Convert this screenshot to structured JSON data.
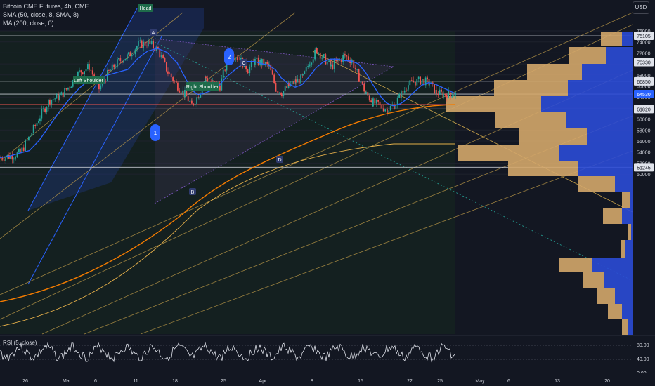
{
  "header": {
    "title": "Bitcoin CME Futures, 4h, CME",
    "sma_label": "SMA (50, close, 8, SMA, 8)",
    "ma_label": "MA (200, close, 0)",
    "currency_button": "USD"
  },
  "colors": {
    "background": "#131722",
    "up": "#26a69a",
    "down": "#ef5350",
    "sma": "#2962ff",
    "ma200": "#f57c00",
    "fib": "#c8a24a",
    "pattern_blue": "#2962ff",
    "pattern_purple": "#9c27b0",
    "volume_sell": "#d4a76a",
    "volume_buy": "#2b4bd6",
    "level_line": "#e0e3eb"
  },
  "rsi": {
    "label": "RSI (5, close)",
    "axis": [
      "80.00",
      "40.00",
      "0.00"
    ]
  },
  "annotations": {
    "head": "Head",
    "left_shoulder": "Left Shoulder",
    "right_shoulder": "Right Shoulder",
    "wave_1": "1",
    "wave_2": "2",
    "point_a": "A",
    "point_b": "B",
    "point_c": "C",
    "point_d": "D"
  },
  "chart_data": {
    "type": "candlestick",
    "title": "Bitcoin CME Futures, 4h, CME",
    "y_axis_ticks": [
      "76000",
      "74000",
      "72000",
      "70000",
      "68000",
      "66000",
      "64000",
      "62000",
      "60000",
      "58000",
      "56000",
      "54000",
      "52000",
      "50000"
    ],
    "ylim": [
      48000,
      76500
    ],
    "x_axis_ticks": [
      "26",
      "Mar",
      "6",
      "11",
      "18",
      "25",
      "Apr",
      "8",
      "15",
      "22",
      "25",
      "May",
      "6",
      "13",
      "20"
    ],
    "price_levels": [
      {
        "label": "75105",
        "value": 75105
      },
      {
        "label": "70330",
        "value": 70330
      },
      {
        "label": "66850",
        "value": 66850
      },
      {
        "label": "64530",
        "value": 64530,
        "current": true
      },
      {
        "label": "61820",
        "value": 61820
      },
      {
        "label": "51245",
        "value": 51245
      }
    ],
    "series": [
      {
        "name": "SMA (50, close, 8, SMA, 8)"
      },
      {
        "name": "MA (200, close, 0)"
      }
    ],
    "close_path": [
      [
        0,
        53000
      ],
      [
        14,
        53300
      ],
      [
        28,
        53800
      ],
      [
        42,
        57000
      ],
      [
        56,
        60500
      ],
      [
        70,
        63500
      ],
      [
        84,
        64000
      ],
      [
        98,
        66000
      ],
      [
        112,
        68500
      ],
      [
        126,
        69500
      ],
      [
        140,
        65500
      ],
      [
        154,
        68500
      ],
      [
        168,
        70500
      ],
      [
        182,
        71500
      ],
      [
        196,
        73500
      ],
      [
        210,
        73800
      ],
      [
        224,
        72500
      ],
      [
        238,
        68500
      ],
      [
        252,
        66000
      ],
      [
        262,
        64500
      ],
      [
        272,
        62500
      ],
      [
        282,
        64500
      ],
      [
        292,
        67500
      ],
      [
        302,
        66500
      ],
      [
        312,
        66000
      ],
      [
        322,
        70500
      ],
      [
        332,
        71800
      ],
      [
        342,
        70500
      ],
      [
        352,
        69000
      ],
      [
        362,
        70500
      ],
      [
        372,
        70200
      ],
      [
        382,
        69500
      ],
      [
        392,
        65500
      ],
      [
        400,
        64800
      ],
      [
        410,
        66000
      ],
      [
        420,
        66800
      ],
      [
        430,
        67500
      ],
      [
        440,
        70500
      ],
      [
        450,
        72500
      ],
      [
        460,
        71000
      ],
      [
        470,
        69500
      ],
      [
        480,
        70500
      ],
      [
        490,
        71500
      ],
      [
        500,
        70500
      ],
      [
        510,
        67500
      ],
      [
        520,
        64500
      ],
      [
        530,
        63000
      ],
      [
        540,
        62300
      ],
      [
        550,
        61800
      ],
      [
        560,
        62500
      ],
      [
        570,
        64500
      ],
      [
        580,
        66200
      ],
      [
        590,
        66800
      ],
      [
        600,
        67000
      ],
      [
        610,
        66500
      ],
      [
        620,
        64800
      ],
      [
        630,
        64500
      ],
      [
        640,
        64600
      ],
      [
        648,
        64530
      ]
    ]
  }
}
